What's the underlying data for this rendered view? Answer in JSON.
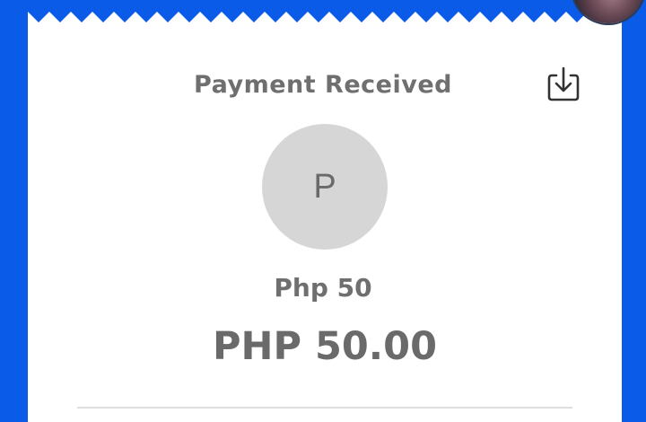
{
  "header": {
    "title": "Payment Received",
    "download_icon": "download-tray-icon"
  },
  "recipient": {
    "initial": "P",
    "name": "Php 50"
  },
  "transaction": {
    "amount": "PHP 50.00"
  },
  "colors": {
    "background_accent": "#0a5be8",
    "text_gray": "#6f6f6f",
    "avatar_bg": "#d6d6d6"
  }
}
